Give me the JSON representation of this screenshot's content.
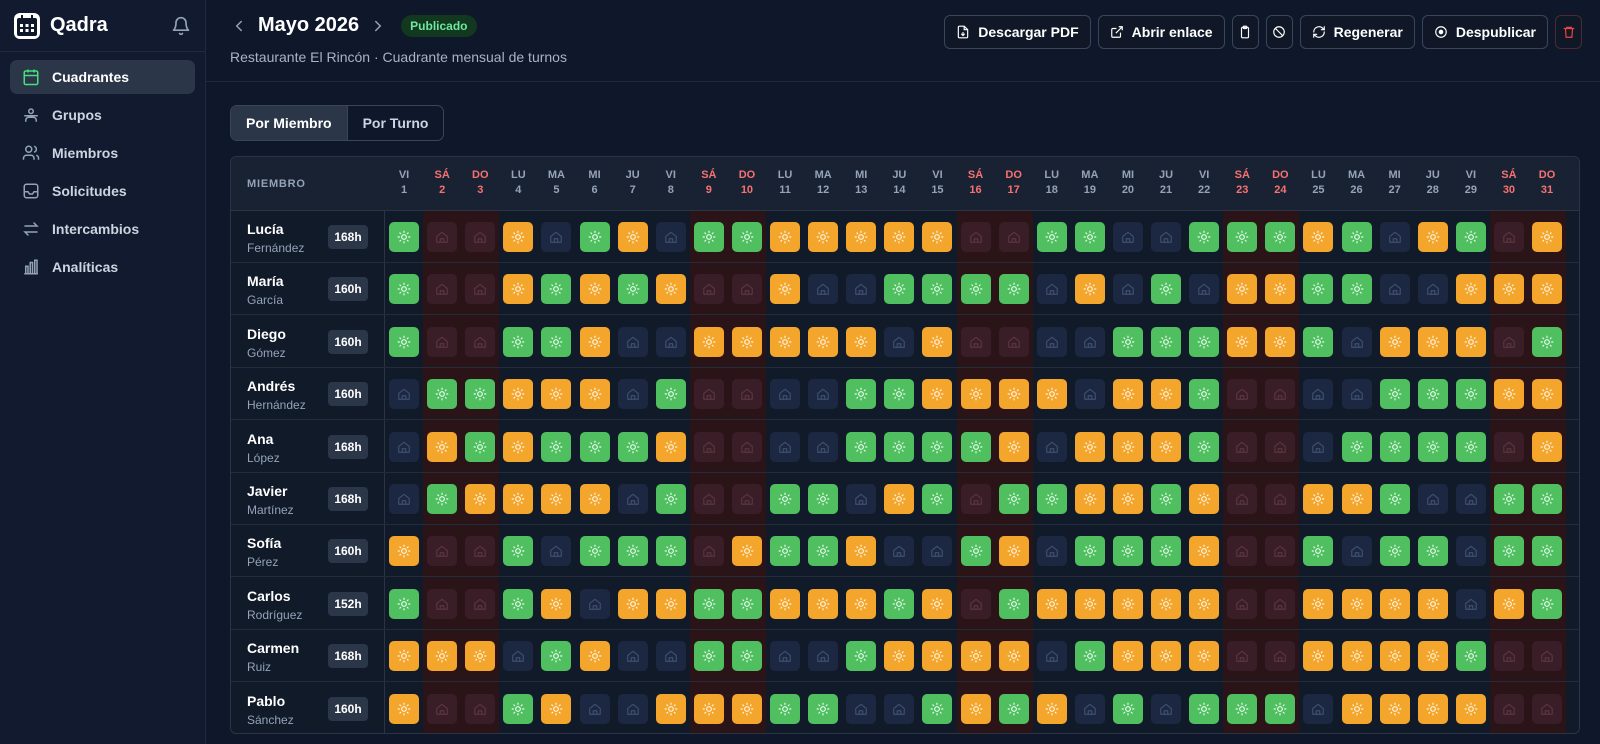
{
  "app": {
    "name": "Qadra"
  },
  "nav": [
    {
      "label": "Cuadrantes",
      "icon": "calendar-icon",
      "active": true
    },
    {
      "label": "Grupos",
      "icon": "group-icon",
      "active": false
    },
    {
      "label": "Miembros",
      "icon": "users-icon",
      "active": false
    },
    {
      "label": "Solicitudes",
      "icon": "inbox-icon",
      "active": false
    },
    {
      "label": "Intercambios",
      "icon": "swap-icon",
      "active": false
    },
    {
      "label": "Analíticas",
      "icon": "chart-icon",
      "active": false
    }
  ],
  "header": {
    "title": "Mayo 2026",
    "status": "Publicado",
    "subtitle": "Restaurante El Rincón · Cuadrante mensual de turnos",
    "actions": {
      "download": "Descargar PDF",
      "open_link": "Abrir enlace",
      "regenerate": "Regenerar",
      "unpublish": "Despublicar"
    }
  },
  "view_toggle": {
    "by_member": "Por Miembro",
    "by_shift": "Por Turno",
    "selected": "by_member"
  },
  "grid": {
    "member_header": "MIEMBRO",
    "days": [
      {
        "dow": "VI",
        "d": "1",
        "we": false
      },
      {
        "dow": "SÁ",
        "d": "2",
        "we": true
      },
      {
        "dow": "DO",
        "d": "3",
        "we": true
      },
      {
        "dow": "LU",
        "d": "4",
        "we": false
      },
      {
        "dow": "MA",
        "d": "5",
        "we": false
      },
      {
        "dow": "MI",
        "d": "6",
        "we": false
      },
      {
        "dow": "JU",
        "d": "7",
        "we": false
      },
      {
        "dow": "VI",
        "d": "8",
        "we": false
      },
      {
        "dow": "SÁ",
        "d": "9",
        "we": true
      },
      {
        "dow": "DO",
        "d": "10",
        "we": true
      },
      {
        "dow": "LU",
        "d": "11",
        "we": false
      },
      {
        "dow": "MA",
        "d": "12",
        "we": false
      },
      {
        "dow": "MI",
        "d": "13",
        "we": false
      },
      {
        "dow": "JU",
        "d": "14",
        "we": false
      },
      {
        "dow": "VI",
        "d": "15",
        "we": false
      },
      {
        "dow": "SÁ",
        "d": "16",
        "we": true
      },
      {
        "dow": "DO",
        "d": "17",
        "we": true
      },
      {
        "dow": "LU",
        "d": "18",
        "we": false
      },
      {
        "dow": "MA",
        "d": "19",
        "we": false
      },
      {
        "dow": "MI",
        "d": "20",
        "we": false
      },
      {
        "dow": "JU",
        "d": "21",
        "we": false
      },
      {
        "dow": "VI",
        "d": "22",
        "we": false
      },
      {
        "dow": "SÁ",
        "d": "23",
        "we": true
      },
      {
        "dow": "DO",
        "d": "24",
        "we": true
      },
      {
        "dow": "LU",
        "d": "25",
        "we": false
      },
      {
        "dow": "MA",
        "d": "26",
        "we": false
      },
      {
        "dow": "MI",
        "d": "27",
        "we": false
      },
      {
        "dow": "JU",
        "d": "28",
        "we": false
      },
      {
        "dow": "VI",
        "d": "29",
        "we": false
      },
      {
        "dow": "SÁ",
        "d": "30",
        "we": true
      },
      {
        "dow": "DO",
        "d": "31",
        "we": true
      }
    ],
    "legend_shift_codes": {
      "M": "green-sun-icon",
      "T": "orange-sun-icon",
      "O": "home-icon"
    },
    "members": [
      {
        "first": "Lucía",
        "last": "Fernández",
        "hours": "168h",
        "shifts": "MOOTOMTOMMTTTTTOOMMOOMMMTMOTMOT"
      },
      {
        "first": "María",
        "last": "García",
        "hours": "160h",
        "shifts": "MOOTMTMTOOTOOMMMMOTOMOTTMMOOTTT"
      },
      {
        "first": "Diego",
        "last": "Gómez",
        "hours": "160h",
        "shifts": "MOOMMTOOTTTTTOTOOOOMMMTTMOTTTOM"
      },
      {
        "first": "Andrés",
        "last": "Hernández",
        "hours": "160h",
        "shifts": "OMMTTTOMOOOOMMTTTTOTTMOOOOMMMTT"
      },
      {
        "first": "Ana",
        "last": "López",
        "hours": "168h",
        "shifts": "OTMTMMMTOOOOMMMMTOTTTMOOOMMMMOT"
      },
      {
        "first": "Javier",
        "last": "Martínez",
        "hours": "168h",
        "shifts": "OMTTTTOMOOMMOTMOMMTTMTOOTTMOOMM"
      },
      {
        "first": "Sofía",
        "last": "Pérez",
        "hours": "160h",
        "shifts": "TOOMOMMMOTMMTOOMTOMMMTOOMOMMOMM"
      },
      {
        "first": "Carlos",
        "last": "Rodríguez",
        "hours": "152h",
        "shifts": "MOOMTOTTMMTTTMTOMTTTTTOOTTTTOTM"
      },
      {
        "first": "Carmen",
        "last": "Ruiz",
        "hours": "168h",
        "shifts": "TTTOMTOOMMOOMTTTTOMTTTOOTTTTMOO"
      },
      {
        "first": "Pablo",
        "last": "Sánchez",
        "hours": "160h",
        "shifts": "TOOMTOOTTTMMOOMTMTOMOMMMOTTTTOO"
      }
    ]
  }
}
